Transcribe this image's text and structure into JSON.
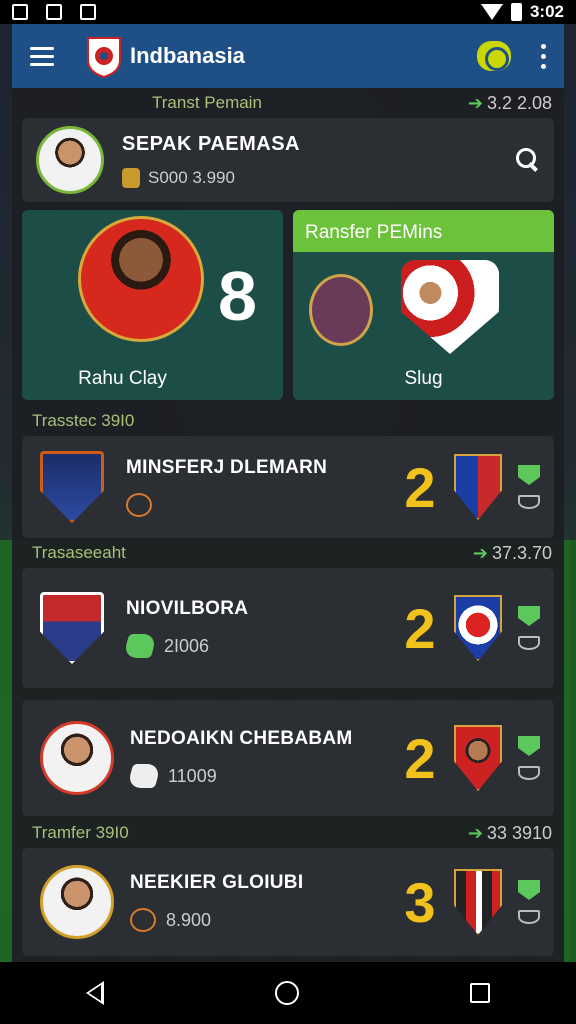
{
  "status_bar": {
    "time": "3:02"
  },
  "app_bar": {
    "title": "Indbanasia"
  },
  "transfer_header": {
    "label": "Transt Pemain",
    "amount": "3.2 2.08"
  },
  "search_card": {
    "title": "SEPAK PAEMASA",
    "value": "S000 3.990"
  },
  "feature_left": {
    "number": "8",
    "name": "Rahu Clay"
  },
  "feature_right": {
    "header": "Ransfer PEMins",
    "label": "Slug"
  },
  "sections": [
    {
      "label": "Trasstec 39I0",
      "amount": ""
    },
    {
      "label": "Trasaseeaht",
      "amount": "37.3.70"
    },
    {
      "label": "Tramfer 39I0",
      "amount": "33 3910"
    }
  ],
  "list_items": [
    {
      "title": "MINSFERJ DLEMARN",
      "sub": "",
      "number": "2"
    },
    {
      "title": "NIOVILBORA",
      "sub": "2I006",
      "number": "2"
    },
    {
      "title": "NEDOAIKN CHEBABAM",
      "sub": "11009",
      "number": "2"
    },
    {
      "title": "NEEKIER GLOIUBI",
      "sub": "8.900",
      "number": "3"
    }
  ],
  "colors": {
    "app_bar": "#1e4f87",
    "accent_green": "#6cc23a",
    "number_yellow": "#f2c21c"
  }
}
